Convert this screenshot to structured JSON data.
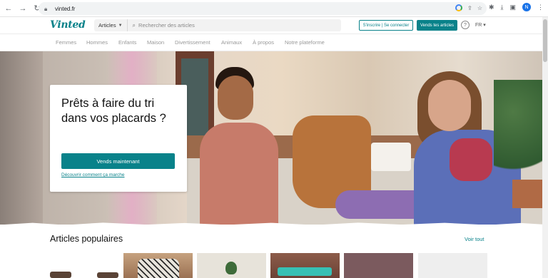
{
  "browser": {
    "url": "vinted.fr",
    "profile_initial": "N"
  },
  "header": {
    "logo": "Vinted",
    "search_category": "Articles",
    "search_placeholder": "Rechercher des articles",
    "login_label": "S'inscrire | Se connecter",
    "sell_label": "Vends tes articles",
    "help_icon": "?",
    "language": "FR"
  },
  "categories": [
    "Femmes",
    "Hommes",
    "Enfants",
    "Maison",
    "Divertissement",
    "Animaux",
    "À propos",
    "Notre plateforme"
  ],
  "hero": {
    "title": "Prêts à faire du tri dans vos placards ?",
    "cta_label": "Vends maintenant",
    "link_label": "Découvrir comment ça marche"
  },
  "popular": {
    "title": "Articles populaires",
    "see_all": "Voir tout"
  },
  "colors": {
    "brand": "#09828a"
  }
}
